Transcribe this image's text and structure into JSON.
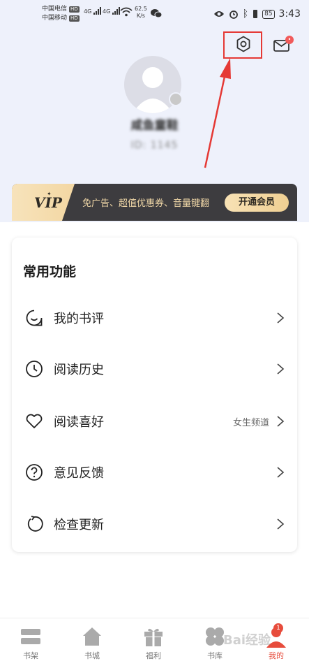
{
  "status_bar": {
    "carrier_1": "中国电信",
    "carrier_2": "中国移动",
    "hd": "HD",
    "sig_1": "4G",
    "sig_2": "4G",
    "net_speed_value": "62.5",
    "net_speed_unit": "K/s",
    "battery": "85",
    "time": "3:43"
  },
  "profile": {
    "username": "咸鱼童鞋",
    "user_id": "ID:  1145"
  },
  "vip_banner": {
    "logo": "VIP",
    "text": "免广告、超值优惠券、音量键翻",
    "button": "开通会员"
  },
  "card": {
    "title": "常用功能",
    "items": [
      {
        "label": "我的书评",
        "value": "",
        "icon": "comment-icon"
      },
      {
        "label": "阅读历史",
        "value": "",
        "icon": "clock-icon"
      },
      {
        "label": "阅读喜好",
        "value": "女生频道",
        "icon": "heart-icon"
      },
      {
        "label": "意见反馈",
        "value": "",
        "icon": "question-icon"
      },
      {
        "label": "检查更新",
        "value": "",
        "icon": "refresh-icon"
      }
    ]
  },
  "tabbar": {
    "tabs": [
      {
        "label": "书架",
        "icon": "bookshelf-icon"
      },
      {
        "label": "书城",
        "icon": "home-icon"
      },
      {
        "label": "福利",
        "icon": "gift-icon"
      },
      {
        "label": "书库",
        "icon": "category-icon"
      },
      {
        "label": "我的",
        "icon": "profile-icon"
      }
    ],
    "badge": "1"
  },
  "watermark": "Bai经验",
  "colors": {
    "accent": "#e53935",
    "background_top": "#eef1fb",
    "vip_dark": "#3d3c3f",
    "vip_gold": "#f0d7a7"
  }
}
